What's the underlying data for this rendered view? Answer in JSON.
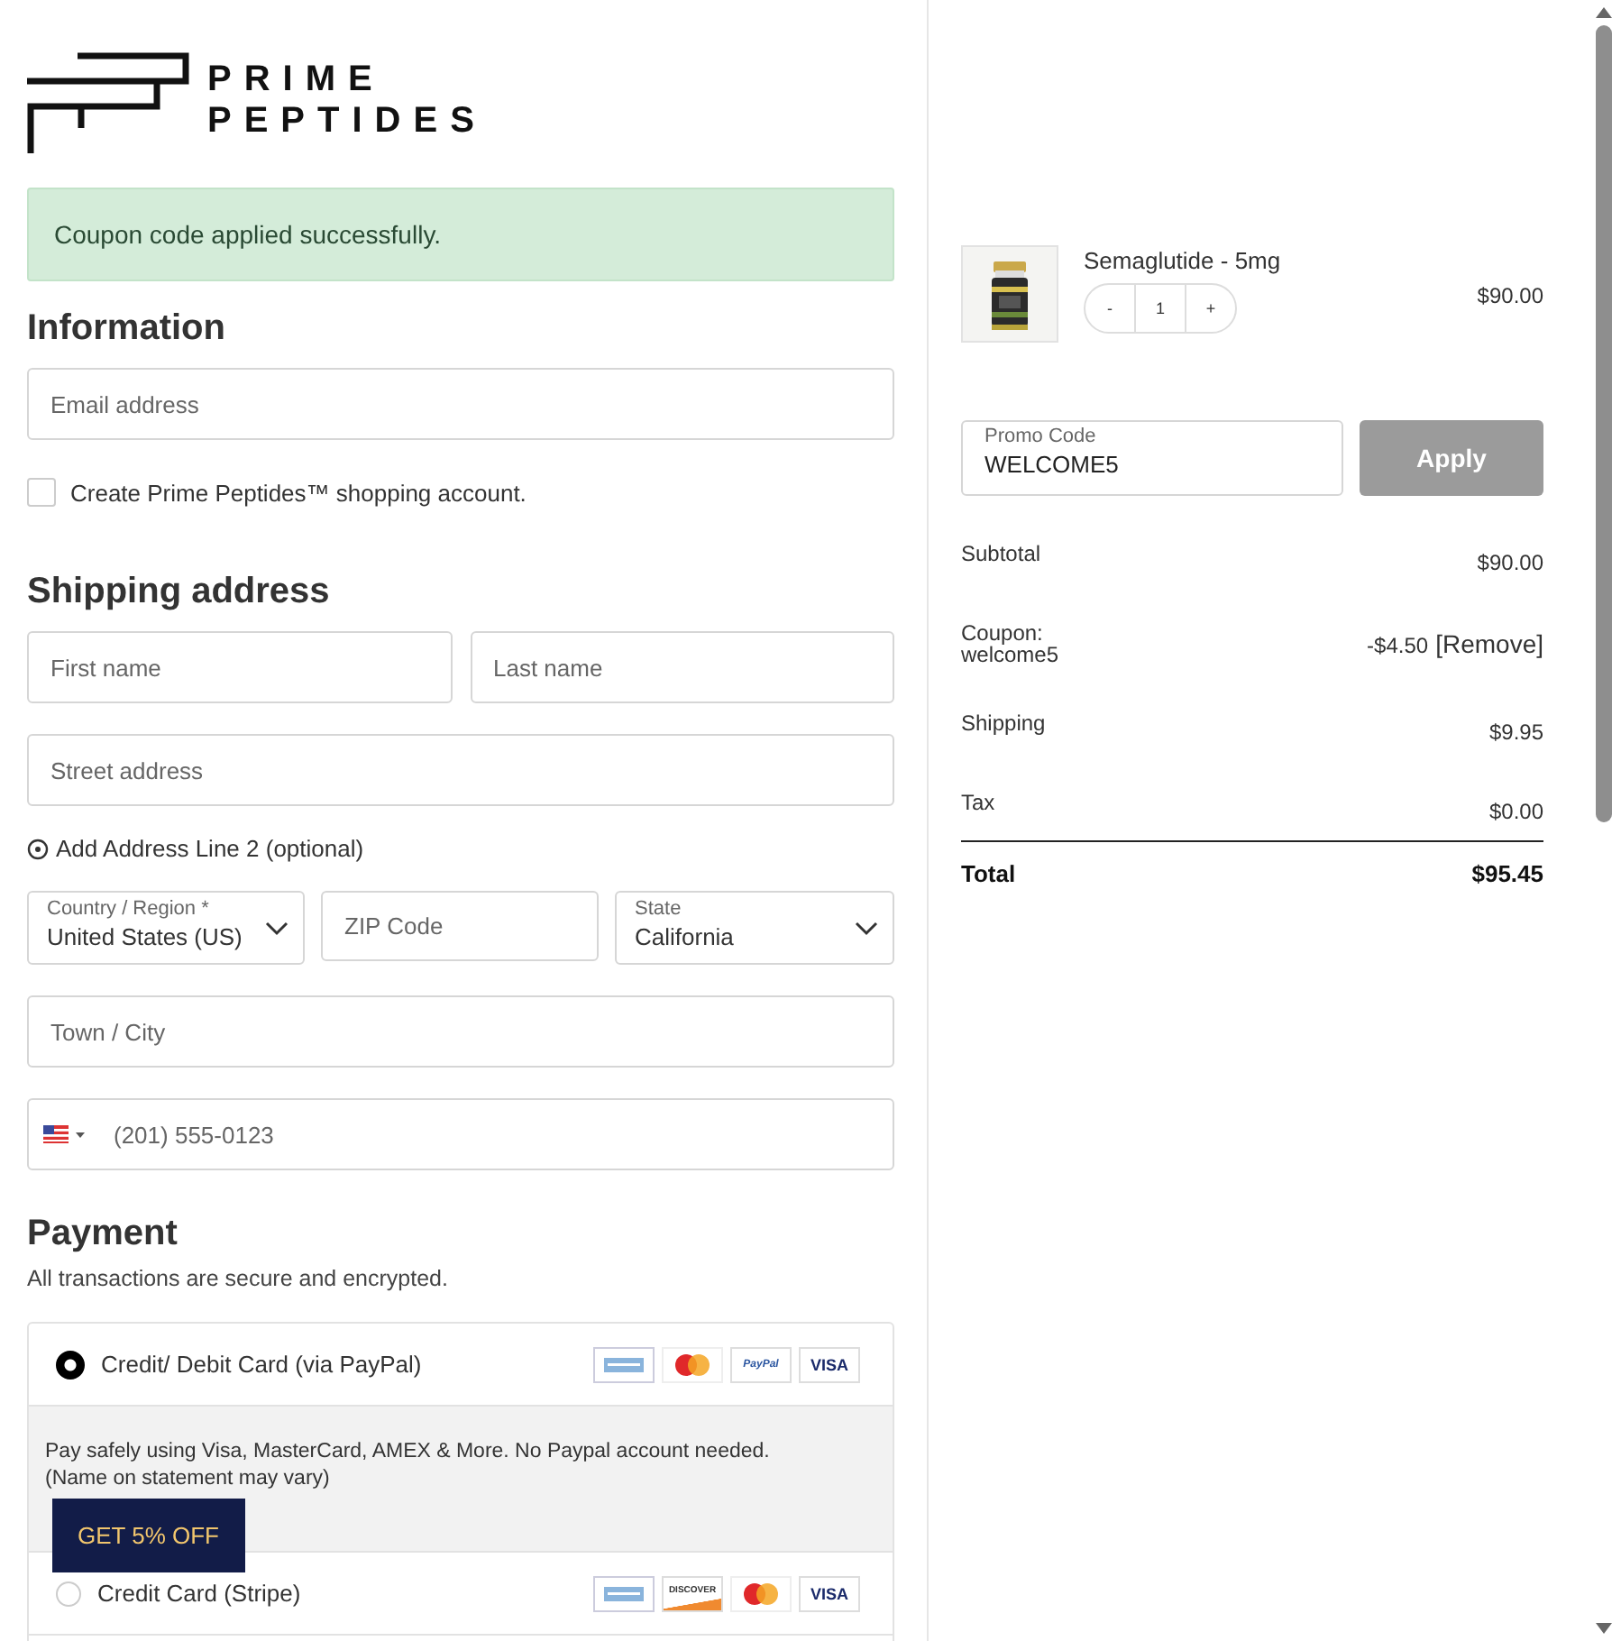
{
  "logo": {
    "line_1": "PRIME",
    "line_2": "PEPTIDES"
  },
  "alert": {
    "text": "Coupon code applied successfully."
  },
  "information": {
    "heading": "Information",
    "email": {
      "placeholder": "Email address"
    },
    "create_account": {
      "label": "Create Prime Peptides™ shopping account.",
      "checked": false
    }
  },
  "shipping": {
    "heading": "Shipping address",
    "first_name": {
      "placeholder": "First name"
    },
    "last_name": {
      "placeholder": "Last name"
    },
    "street": {
      "placeholder": "Street address"
    },
    "add_line_2": "Add Address Line 2 (optional)",
    "country": {
      "label": "Country / Region *",
      "value": "United States (US)"
    },
    "zip": {
      "placeholder": "ZIP Code"
    },
    "state": {
      "label": "State",
      "value": "California"
    },
    "city": {
      "placeholder": "Town / City"
    },
    "phone": {
      "placeholder": "(201) 555-0123"
    }
  },
  "payment": {
    "heading": "Payment",
    "subtitle": "All transactions are secure and encrypted.",
    "methods": [
      {
        "label": "Credit/ Debit Card (via PayPal)",
        "selected": true,
        "cards": [
          {
            "kind": "amex"
          },
          {
            "kind": "mastercard"
          },
          {
            "kind": "paypal",
            "label": "PayPal"
          },
          {
            "kind": "visa",
            "label": "VISA"
          }
        ],
        "description": "Pay safely using Visa, MasterCard, AMEX & More. No Paypal account needed.\n(Name on statement may vary)"
      },
      {
        "label": "Credit Card (Stripe)",
        "selected": false,
        "cards": [
          {
            "kind": "amex"
          },
          {
            "kind": "discover",
            "label": "DISCOVER"
          },
          {
            "kind": "mastercard"
          },
          {
            "kind": "visa",
            "label": "VISA"
          }
        ]
      }
    ]
  },
  "promo_banner": {
    "label": "GET 5% OFF"
  },
  "cart": {
    "items": [
      {
        "name": "Semaglutide - 5mg",
        "minus": "-",
        "quantity": "1",
        "plus": "+",
        "price": "$90.00"
      }
    ],
    "promo": {
      "label": "Promo Code",
      "value": "WELCOME5",
      "button": "Apply"
    },
    "totals": [
      {
        "label": "Subtotal",
        "value": "$90.00"
      },
      {
        "label": "Coupon:\nwelcome5",
        "value": "-$4.50",
        "action": "[Remove]"
      },
      {
        "label": "Shipping",
        "value": "$9.95"
      },
      {
        "label": "Tax",
        "value": "$0.00"
      }
    ],
    "total": {
      "label": "Total",
      "value": "$95.45"
    }
  }
}
